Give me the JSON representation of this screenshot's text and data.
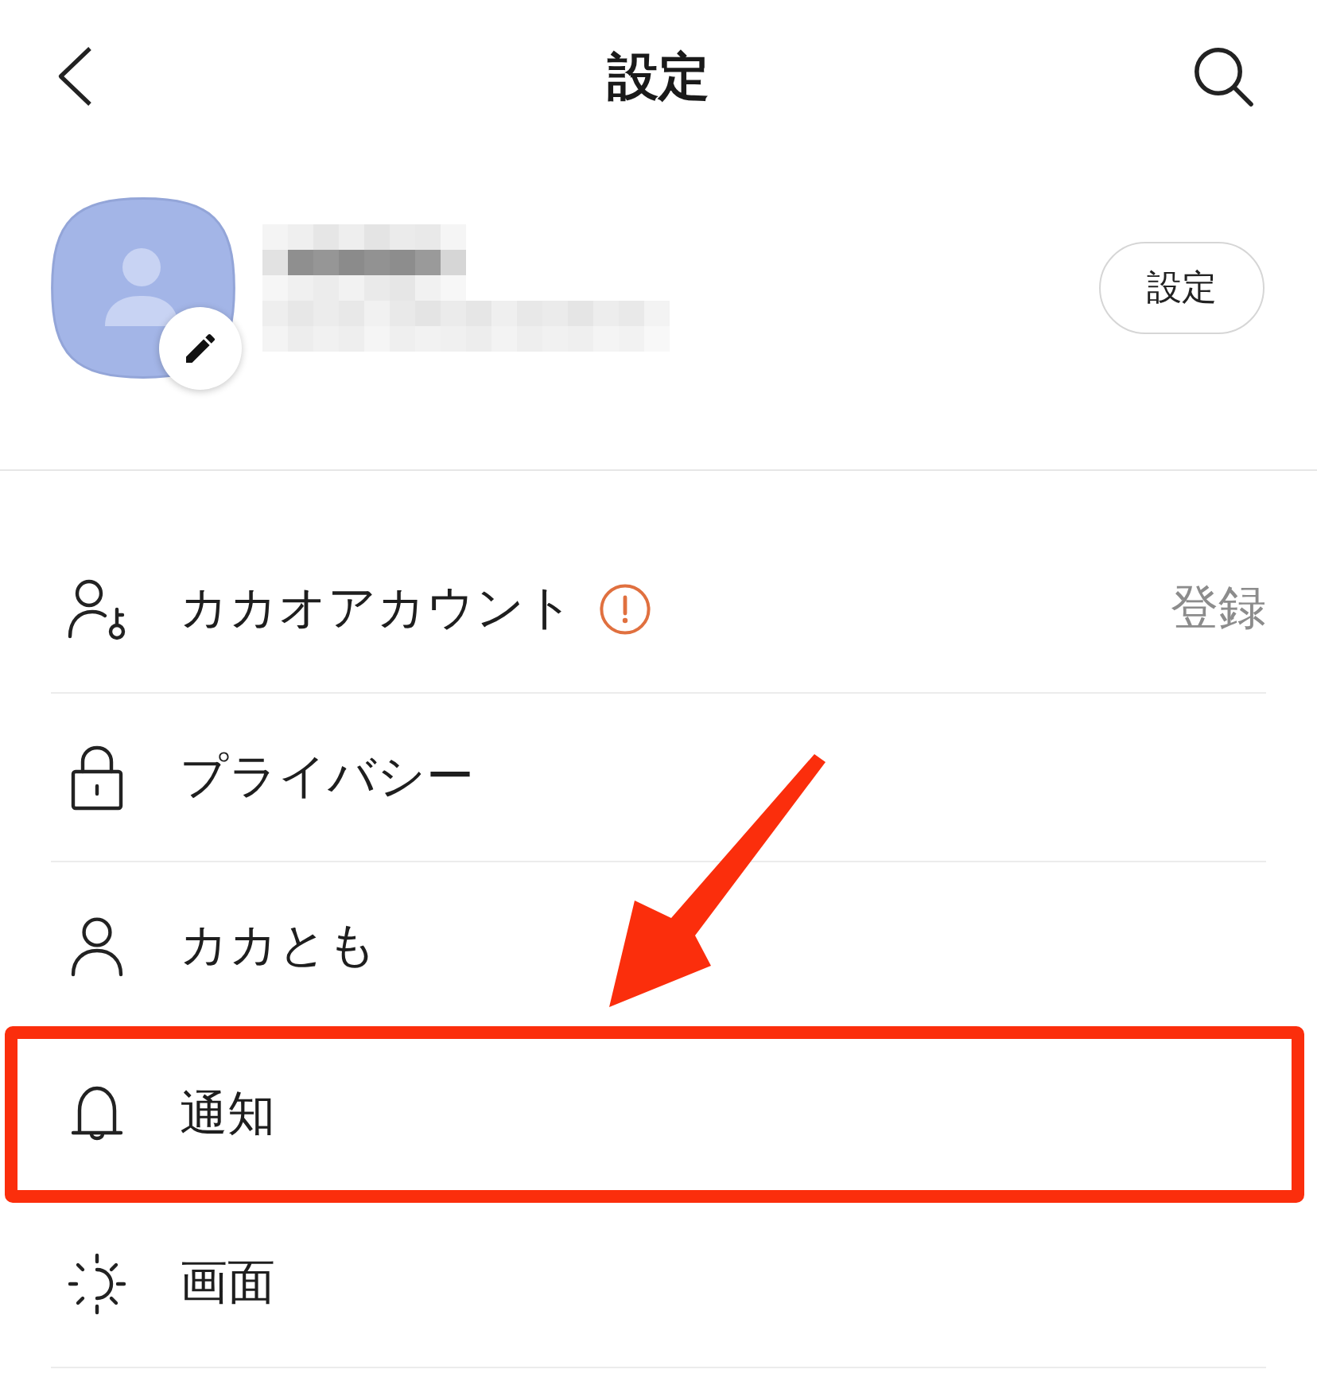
{
  "header": {
    "title": "設定"
  },
  "profile": {
    "button": "設定"
  },
  "menu": [
    {
      "kind": "account",
      "label": "カカオアカウント",
      "warning": true,
      "value": "登録",
      "highlighted": false
    },
    {
      "kind": "privacy",
      "label": "プライバシー",
      "warning": false,
      "highlighted": false
    },
    {
      "kind": "friends",
      "label": "カカとも",
      "warning": false,
      "highlighted": false
    },
    {
      "kind": "notifications",
      "label": "通知",
      "warning": false,
      "highlighted": true
    },
    {
      "kind": "display",
      "label": "画面",
      "warning": false,
      "highlighted": false
    }
  ]
}
